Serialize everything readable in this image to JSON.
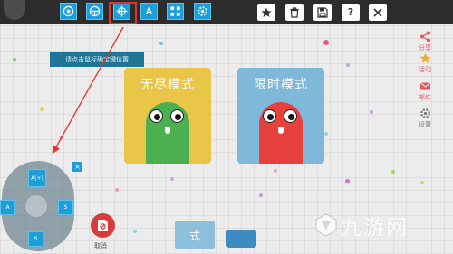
{
  "topbar": {
    "player_name": "",
    "tool_icons": [
      "joystick-icon",
      "steering-icon",
      "crosshair-move-icon",
      "letter-a-key-icon",
      "dpad-icon",
      "settings-gear-icon"
    ],
    "a_key_label": "A",
    "right_icons": [
      "star-icon",
      "trash-icon",
      "save-icon",
      "help-icon",
      "close-icon"
    ],
    "help_label": "?"
  },
  "tooltip": {
    "text": "请点击鼠标确定键位置"
  },
  "modes": {
    "endless": {
      "title": "无尽模式",
      "color": "#e9c648",
      "snake_color": "#4caf50"
    },
    "timed": {
      "title": "限时模式",
      "color": "#7fb8d9",
      "snake_color": "#e8413d"
    }
  },
  "sidebar": {
    "items": [
      {
        "label": "分享",
        "icon": "share-icon"
      },
      {
        "label": "活动",
        "icon": "star-icon"
      },
      {
        "label": "邮件",
        "icon": "mail-icon"
      },
      {
        "label": "设置",
        "icon": "gear-icon"
      }
    ]
  },
  "keypad": {
    "top_label": "A(+)",
    "left_label": "A",
    "right_label": "S",
    "bottom_label": "S",
    "close_label": "×"
  },
  "cancel": {
    "label": "取消",
    "icon": "cancel-file-icon"
  },
  "bottom_button": {
    "label": "式"
  },
  "watermark": {
    "text": "九游网"
  },
  "colors": {
    "accent": "#1d9ed8",
    "highlight": "#e8302a",
    "topbar": "#2c2c2c"
  }
}
